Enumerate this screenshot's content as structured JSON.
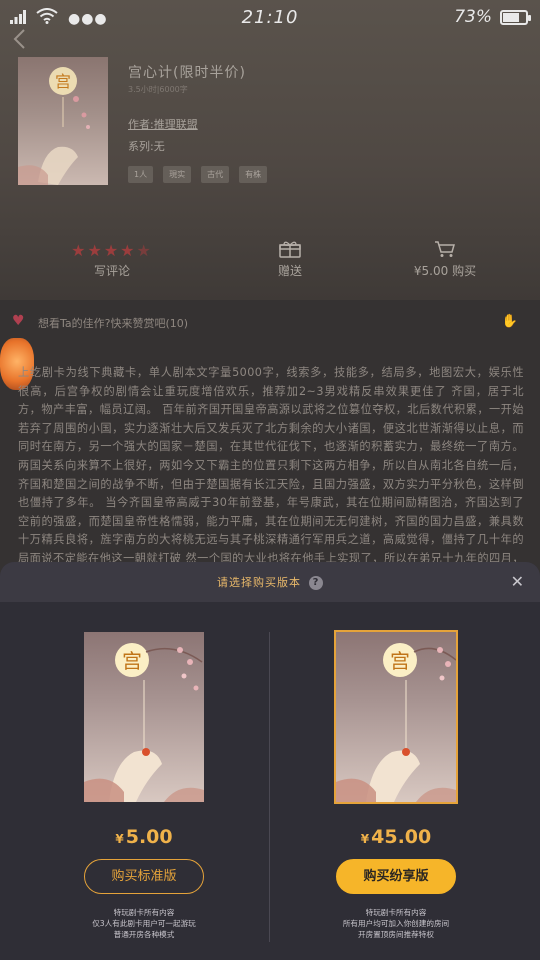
{
  "status_bar": {
    "time": "21:10",
    "battery_text": "73%",
    "battery_level": 0.73,
    "signal_icon": "wifi-icon",
    "more_icon": "more-dots-icon"
  },
  "book": {
    "title": "宫心计(限时半价)",
    "meta": "3.5小时|6000字",
    "author": "作者:推理联盟",
    "series": "系列:无",
    "tags": [
      "1人",
      "現实",
      "古代",
      "有株"
    ],
    "cover_char": "宫"
  },
  "actions": {
    "rating_stars": 4.5,
    "rating_label": "写评论",
    "gift_label": "赠送",
    "buy_label": "¥5.00 购买"
  },
  "fan_row": {
    "text": "想看Ta的佳作?快来赞赏吧(10)"
  },
  "body_text": "上纥剧卡为线下典藏卡，单人剧本文字量5000字，线索多，技能多，结局多，地图宏大，娱乐性很高，后宫争权的剧情会让重玩度增倍欢乐，推荐加2~3男戏精反串效果更佳了  齐国，居于北方，物产丰富，幅员辽阔。  百年前齐国开国皇帝高源以武将之位篡位夺权，北后数代积累，一开始若弃了周围的小国，实力逐渐壮大后又发兵灭了北方剩余的大小诸国，便这北世渐渐得以止息，而同时在南方，另一个强大的国家－楚国，在其世代征伐下，也逐渐的积蓄实力，最终统一了南方。 两国关系向来算不上很好，两如今又下霸主的位置只剩下这两方相争，所以自从南北各自统一后，齐国和楚国之间的战争不断，但由于楚国据有长江天险，且国力强盛，双方实力平分秋色，这样倒也僵持了多年。 当今齐国皇帝高威于30年前登基，年号康武，其在位期间励精图治，齐国达到了空前的强盛，而楚国皇帝性格懦弱，能力平庸，其在位期间无无何建树，齐国的国力昌盛，兼具数十万精兵良将，旌字南方的大将桃无远与其子桃深精通行军用兵之道，高威觉得，僵持了几十年的局面说不定能在他这一朝就打破 然一个国的大业也将在他手上实现了，所以在弟兄十九年的四月，高威下",
  "dialog": {
    "title": "请选择购买版本",
    "help_icon": "help-icon",
    "close_icon": "close-icon",
    "options": [
      {
        "price_symbol": "¥",
        "price": "5.00",
        "button_label": "购买标准版",
        "desc_lines": [
          "特玩剧卡所有内容",
          "仅3人有此剧卡用户可一起游玩",
          "普通开房各种模式"
        ]
      },
      {
        "price_symbol": "¥",
        "price": "45.00",
        "button_label": "购买纷享版",
        "desc_lines": [
          "特玩剧卡所有内容",
          "所有用户均可加入你创建的房间",
          "开房置顶房间推荐特权"
        ]
      }
    ]
  },
  "colors": {
    "accent": "#F6B529",
    "price": "#F0B24A",
    "dialog_bg": "#2F2E36",
    "star": "#9B3D3D"
  }
}
